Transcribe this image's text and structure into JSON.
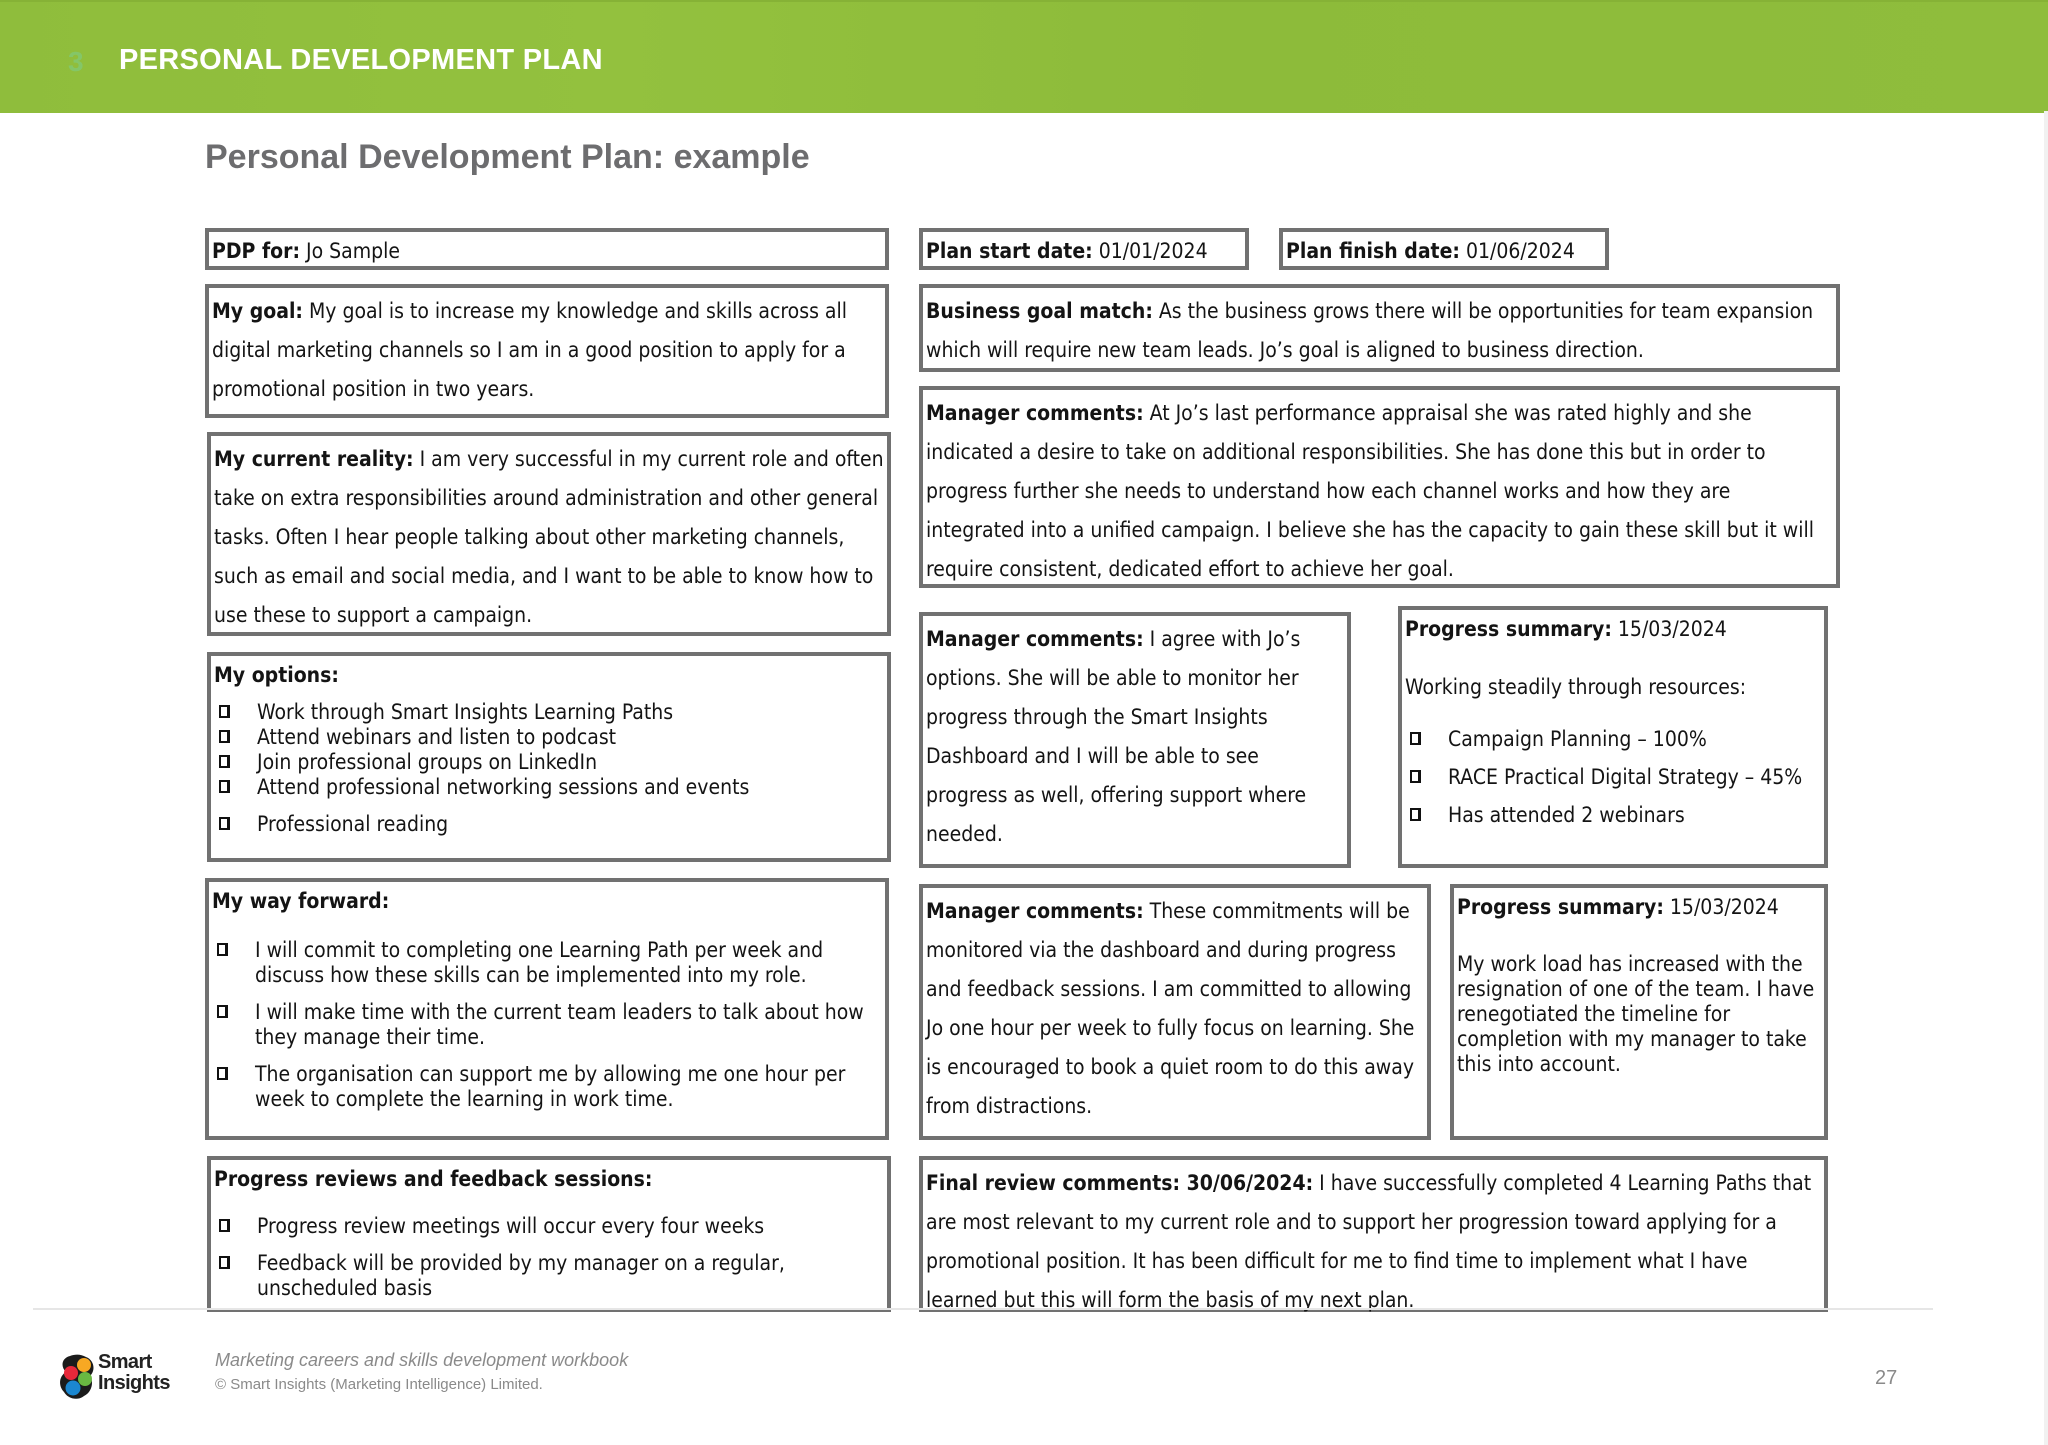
{
  "header": {
    "section_number": "3",
    "section_title": "PERSONAL DEVELOPMENT PLAN",
    "brand_color": "#8fbd3c"
  },
  "page_title": "Personal Development Plan: example",
  "pdp_for": {
    "label": "PDP for:",
    "value": "Jo Sample"
  },
  "plan_start": {
    "label": "Plan start date:",
    "value": "01/01/2024"
  },
  "plan_finish": {
    "label": "Plan finish date:",
    "value": "01/06/2024"
  },
  "my_goal": {
    "label": "My goal:",
    "text": "My goal is to increase my knowledge and skills across all digital marketing channels so I am in a good position to apply for a promotional position in two years."
  },
  "current_reality": {
    "label": "My current reality:",
    "text": "I am very successful in my current role and often take on extra responsibilities around administration and other general tasks. Often I hear people talking about other marketing channels, such as email and social media, and I want to be able to know how to use these to support a campaign."
  },
  "my_options": {
    "label": "My options:",
    "items": [
      "Work through Smart Insights Learning Paths",
      "Attend webinars and listen to podcast",
      "Join professional groups on LinkedIn",
      "Attend professional networking sessions and events",
      "Professional reading"
    ]
  },
  "way_forward": {
    "label": "My way forward:",
    "items": [
      "I will commit to completing one Learning Path per week and discuss how these skills can be implemented into my role.",
      "I will make time with the current team leaders to talk about how they manage their time.",
      "The organisation can support me by allowing me one hour per week to complete the learning in work time."
    ]
  },
  "progress_reviews": {
    "label": "Progress reviews and feedback sessions:",
    "items": [
      "Progress review meetings will occur every four weeks",
      "Feedback will be provided by my manager on a regular, unscheduled basis"
    ]
  },
  "business_goal": {
    "label": "Business goal match:",
    "text": "As the business grows there will be opportunities for team expansion which will require new team leads. Jo’s goal is aligned to business direction."
  },
  "manager_comments_1": {
    "label": "Manager comments:",
    "text": "At Jo’s last performance appraisal she was rated highly and she indicated a desire to take on additional responsibilities. She has done this but in order to progress further she needs to understand how each channel works and how they are integrated into a unified campaign. I believe she has the capacity to gain these skill but it will require consistent, dedicated effort to achieve her goal."
  },
  "manager_comments_2": {
    "label": "Manager comments:",
    "text": "I agree with Jo’s options. She will be able to monitor her progress through the Smart Insights Dashboard and I will be able to see progress as well, offering support where needed."
  },
  "progress_summary_1": {
    "label": "Progress summary:",
    "date": "15/03/2024",
    "intro": "Working steadily through resources:",
    "items": [
      "Campaign Planning – 100%",
      "RACE Practical Digital Strategy – 45%",
      "Has attended 2 webinars"
    ]
  },
  "manager_comments_3": {
    "label": "Manager comments:",
    "text": "These commitments will be monitored via the dashboard and during progress and feedback sessions. I am committed to allowing Jo one hour per week to fully focus on learning. She is encouraged to book a quiet room to do this away from distractions."
  },
  "progress_summary_2": {
    "label": "Progress summary:",
    "date": "15/03/2024",
    "text": "My work load has increased with the resignation of one of the team. I have renegotiated the timeline for completion with my manager to take this into account."
  },
  "final_review": {
    "label": "Final review comments: 30/06/2024:",
    "text": "I have successfully completed 4 Learning Paths that are most relevant to my current role and to support her progression toward applying for a promotional position. It has been difficult for me to find time to implement what I have learned but this will form the basis of my next plan."
  },
  "footer": {
    "logo_line1": "Smart",
    "logo_line2": "Insights",
    "subtitle": "Marketing careers and skills development workbook",
    "copyright": "© Smart Insights (Marketing Intelligence) Limited.",
    "page_number": "27"
  }
}
